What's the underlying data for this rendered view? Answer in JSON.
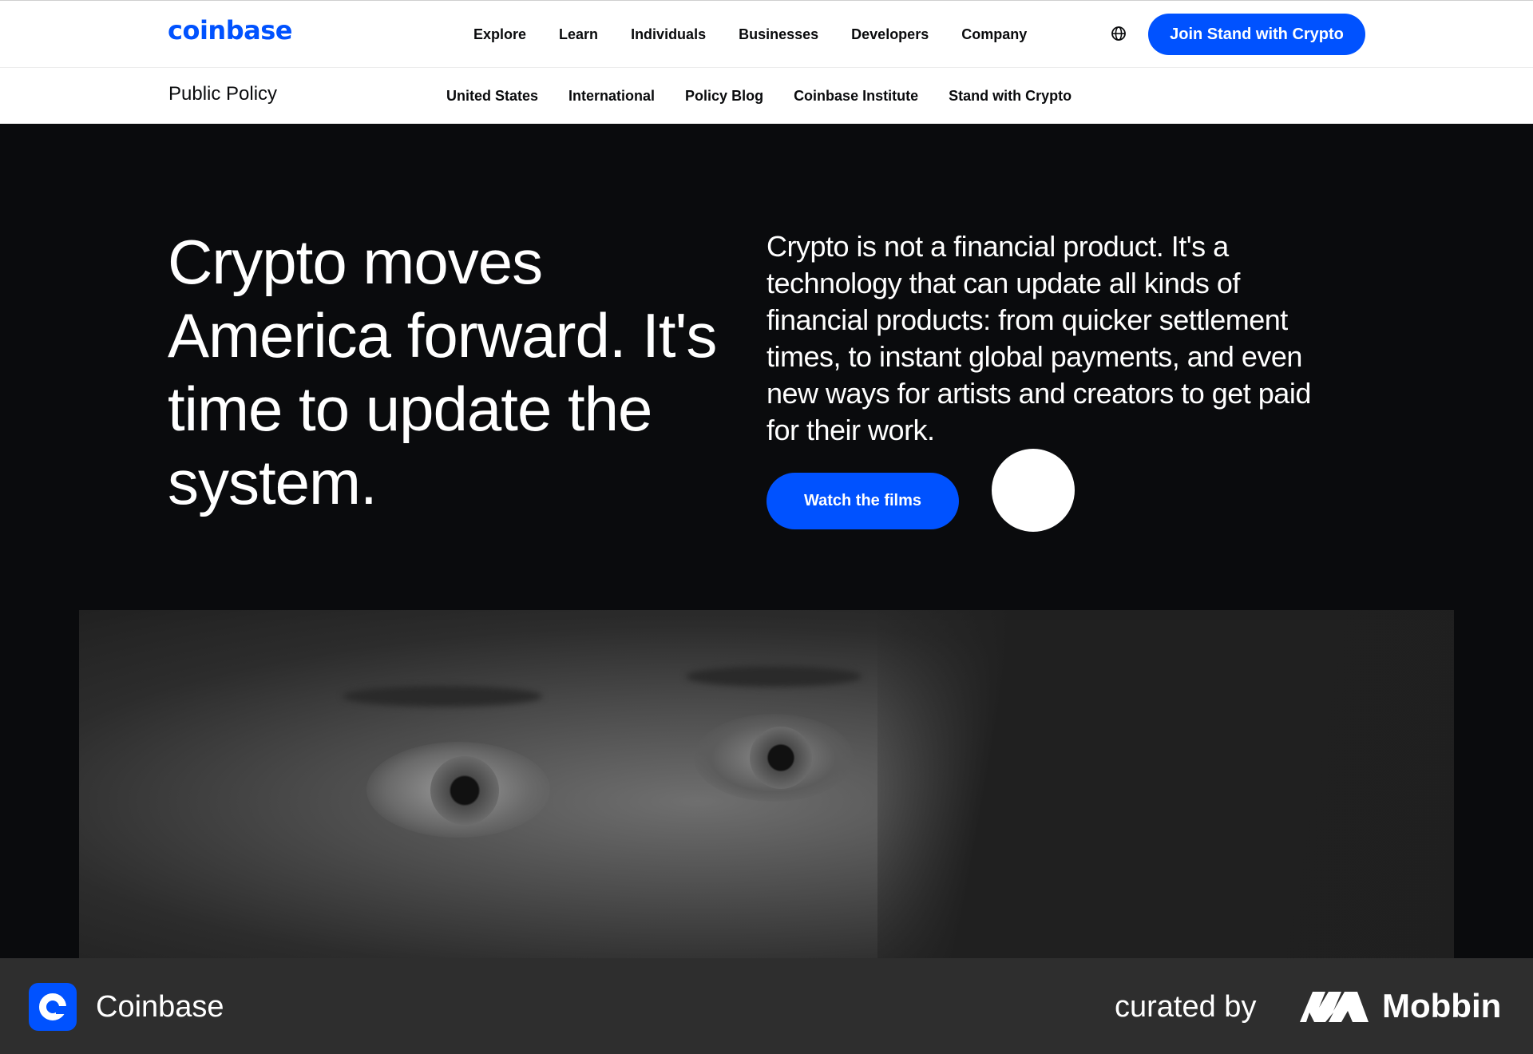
{
  "brand": {
    "logo_text": "coinbase",
    "accent": "#0052ff"
  },
  "top_nav": {
    "items": [
      "Explore",
      "Learn",
      "Individuals",
      "Businesses",
      "Developers",
      "Company"
    ],
    "globe_icon": "globe-icon",
    "cta_label": "Join Stand with Crypto"
  },
  "sub_nav": {
    "title": "Public Policy",
    "items": [
      "United States",
      "International",
      "Policy Blog",
      "Coinbase Institute",
      "Stand with Crypto"
    ]
  },
  "hero": {
    "headline": "Crypto moves America forward. It's time to update the system.",
    "body": "Crypto is not a financial product. It's a technology that can update all kinds of financial products: from quicker settlement times, to instant global payments, and even new ways for artists and creators to get paid for their work.",
    "cta_label": "Watch the films"
  },
  "video": {
    "play_icon": "play-icon"
  },
  "footer": {
    "app_name": "Coinbase",
    "curated_by": "curated by",
    "mobbin": "Mobbin"
  }
}
